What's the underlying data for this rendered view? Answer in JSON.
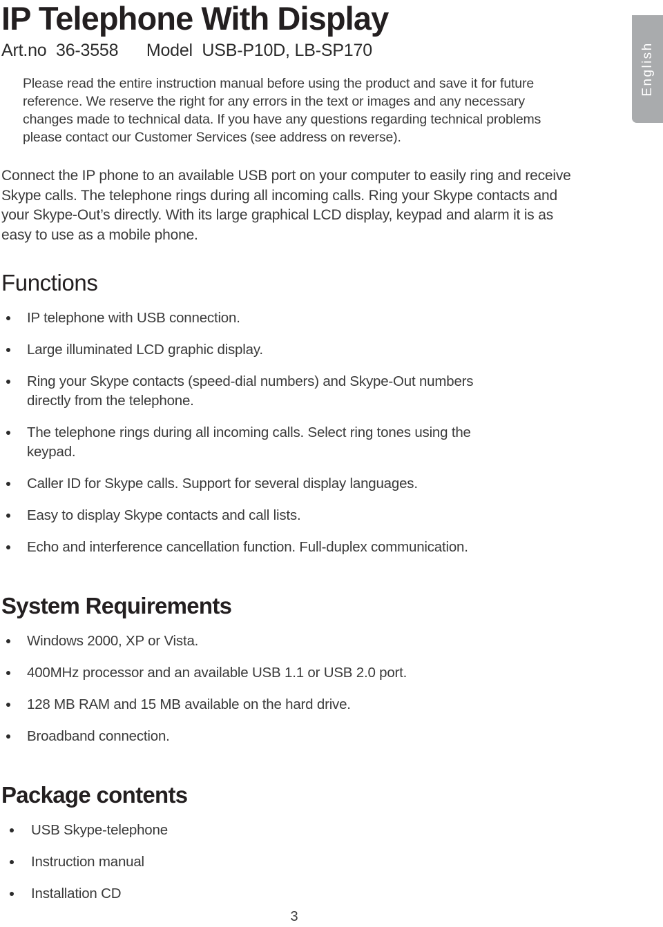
{
  "document": {
    "title": "IP Telephone With Display",
    "subtitle": "Art.no  36-3558      Model  USB-P10D, LB-SP170",
    "page_number": "3"
  },
  "language_tab": {
    "label": "English",
    "background_color": "#a9abad",
    "text_color": "#ffffff"
  },
  "intro": {
    "disclaimer": "Please read the entire instruction manual before using the product and save it for future reference. We reserve the right for any errors in the text or images and any necessary changes made to technical data. If you have any questions regarding technical problems please contact our Customer Services (see address on reverse).",
    "lead": "Connect the IP phone to an available USB port on your computer to easily ring and receive Skype calls. The telephone rings during all incoming calls. Ring your Skype contacts and your Skype-Out’s directly. With its large graphical LCD display, keypad and alarm it is as easy to use as a mobile phone."
  },
  "sections": [
    {
      "id": "functions",
      "title": "Functions",
      "items": [
        "IP telephone with USB connection.",
        "Large illuminated LCD graphic display.",
        "Ring your Skype contacts (speed-dial numbers) and Skype-Out numbers directly from the telephone.",
        "The telephone rings during all incoming calls. Select ring tones using the keypad.",
        "Caller ID for Skype calls. Support for several display languages.",
        "Easy to display Skype contacts and call lists.",
        "Echo and interference cancellation function. Full-duplex communication."
      ]
    },
    {
      "id": "system-requirements",
      "title": "System Requirements",
      "items": [
        "Windows 2000, XP or Vista.",
        "400MHz processor and an available USB 1.1 or USB 2.0 port.",
        "128 MB RAM and 15 MB available on the hard drive.",
        "Broadband connection."
      ]
    },
    {
      "id": "package-contents",
      "title": "Package contents",
      "items": [
        "USB Skype-telephone",
        "Instruction manual",
        "Installation CD"
      ]
    }
  ]
}
